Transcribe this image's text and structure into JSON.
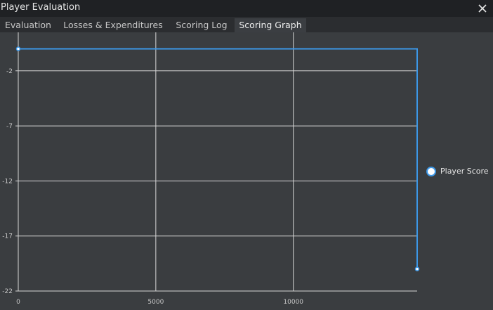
{
  "window": {
    "title": "Player Evaluation",
    "close_icon": "close-icon"
  },
  "tabs": [
    {
      "label": "Evaluation",
      "active": false
    },
    {
      "label": "Losses & Expenditures",
      "active": false
    },
    {
      "label": "Scoring Log",
      "active": false
    },
    {
      "label": "Scoring Graph",
      "active": true
    }
  ],
  "colors": {
    "series": "#3c97e6",
    "grid": "#d6d6d6",
    "plot_background": "#3a3d40",
    "titlebar": "#1f2124"
  },
  "chart_data": {
    "type": "line",
    "title": "",
    "xlabel": "",
    "ylabel": "",
    "xlim": [
      0,
      14500
    ],
    "ylim": [
      -22,
      1.5
    ],
    "x_ticks": [
      0,
      5000,
      10000
    ],
    "y_ticks": [
      -2,
      -7,
      -12,
      -17,
      -22
    ],
    "grid": true,
    "legend_position": "right",
    "step": "post",
    "series": [
      {
        "name": "Player Score",
        "x": [
          0,
          14500
        ],
        "y": [
          0,
          -20
        ]
      }
    ]
  }
}
